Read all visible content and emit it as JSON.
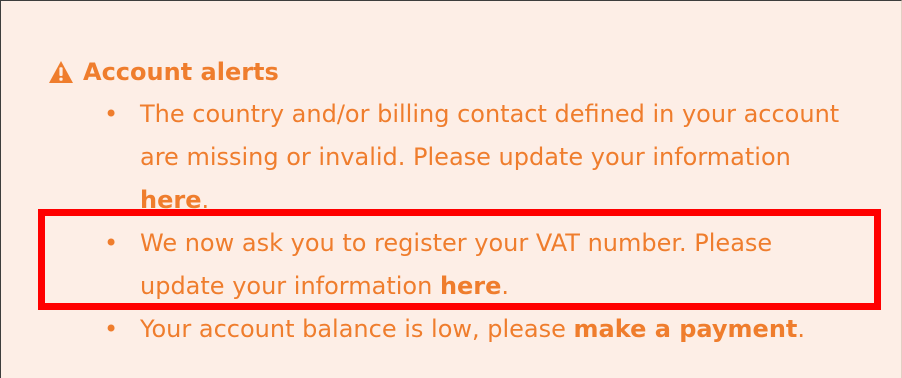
{
  "alerts": {
    "title": "Account alerts",
    "icon": "warning-icon",
    "accent_color": "#ef7d2d",
    "background_color": "#fdeee6",
    "items": [
      {
        "text": "The country and/or billing contact defined in your account are missing or invalid. Please update your information ",
        "link": "here",
        "suffix": "."
      },
      {
        "text": "We now ask you to register your VAT number. Please update your information ",
        "link": "here",
        "suffix": "."
      },
      {
        "text": "Your account balance is low, please ",
        "link": "make a payment",
        "suffix": "."
      }
    ]
  },
  "highlight": {
    "color": "#ff0000"
  }
}
